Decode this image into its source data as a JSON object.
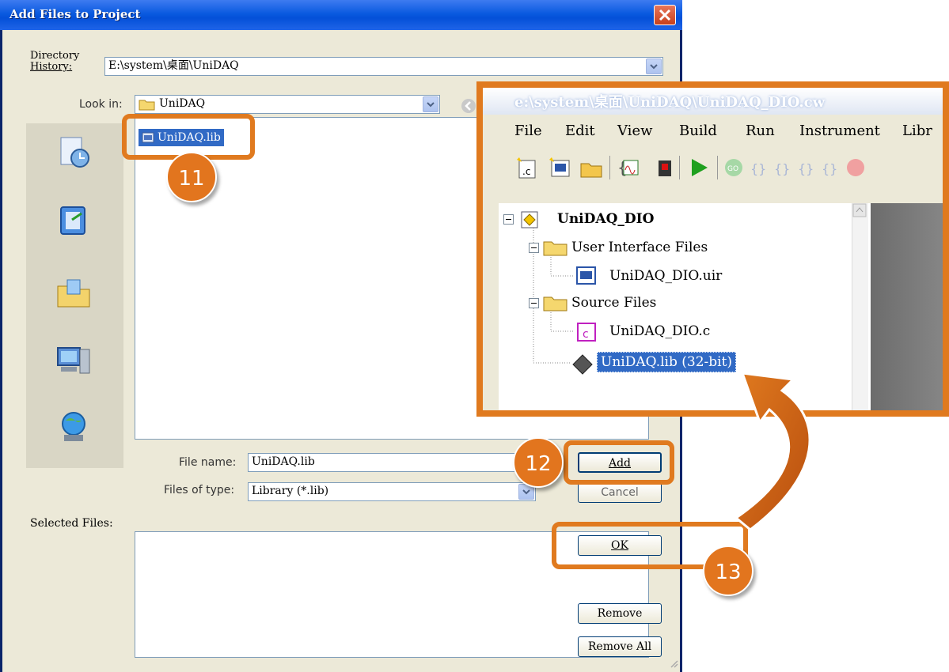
{
  "dialog": {
    "title": "Add Files to Project",
    "directory_history_label_1": "Directory",
    "directory_history_label_2": "History:",
    "directory_history_value": "E:\\system\\桌面\\UniDAQ",
    "look_in_label": "Look in:",
    "look_in_value": "UniDAQ",
    "file_item": "UniDAQ.lib",
    "file_name_label": "File name:",
    "file_name_value": "UniDAQ.lib",
    "files_of_type_label": "Files of type:",
    "files_of_type_value": "Library (*.lib)",
    "selected_files_label": "Selected Files:",
    "buttons": {
      "add": "Add",
      "cancel": "Cancel",
      "ok": "OK",
      "remove": "Remove",
      "remove_all": "Remove All"
    }
  },
  "callouts": [
    "11",
    "12",
    "13"
  ],
  "inset": {
    "title": "e:\\system\\桌面\\UniDAQ\\UniDAQ_DIO.cw",
    "menu": [
      "File",
      "Edit",
      "View",
      "Build",
      "Run",
      "Instrument",
      "Libr"
    ],
    "tree": {
      "root": "UniDAQ_DIO",
      "folder_ui": "User Interface Files",
      "file_uir": "UniDAQ_DIO.uir",
      "folder_src": "Source Files",
      "file_c": "UniDAQ_DIO.c",
      "lib": "UniDAQ.lib (32-bit)"
    }
  },
  "colors": {
    "callout": "#e07a1f",
    "xp_title": "#0a5ae0",
    "selection": "#316ac5"
  }
}
